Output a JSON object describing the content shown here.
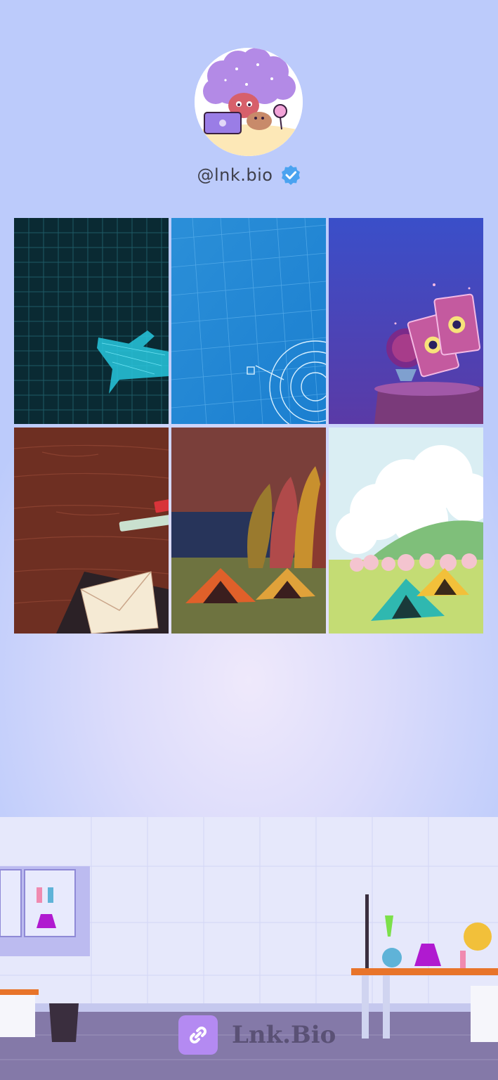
{
  "profile": {
    "handle": "@lnk.bio",
    "verified": true,
    "avatar_icon": "cartoon-avatar-illustration",
    "verified_icon": "verified-badge-icon"
  },
  "grid": {
    "tiles": [
      {
        "name": "tile-airplane-blueprint",
        "theme": "dark teal grid with cyan wireframe airplane"
      },
      {
        "name": "tile-blue-blueprint",
        "theme": "blue blueprint grid with circular schematic"
      },
      {
        "name": "tile-tarot-cards",
        "theme": "purple night with tarot cards and crystal ball"
      },
      {
        "name": "tile-wood-desk-envelope",
        "theme": "wooden desk with envelope and chalk"
      },
      {
        "name": "tile-autumn-camping",
        "theme": "autumn forest with orange and yellow tents"
      },
      {
        "name": "tile-spring-camping",
        "theme": "spring meadow with teal and yellow tents"
      }
    ]
  },
  "footer": {
    "brand_name": "Lnk.Bio",
    "brand_icon": "link-icon",
    "brand_color": "#b48af2"
  },
  "colors": {
    "background_top": "#bccbfb",
    "background_center": "#efe9fb",
    "verified_blue": "#4aa3f0"
  }
}
